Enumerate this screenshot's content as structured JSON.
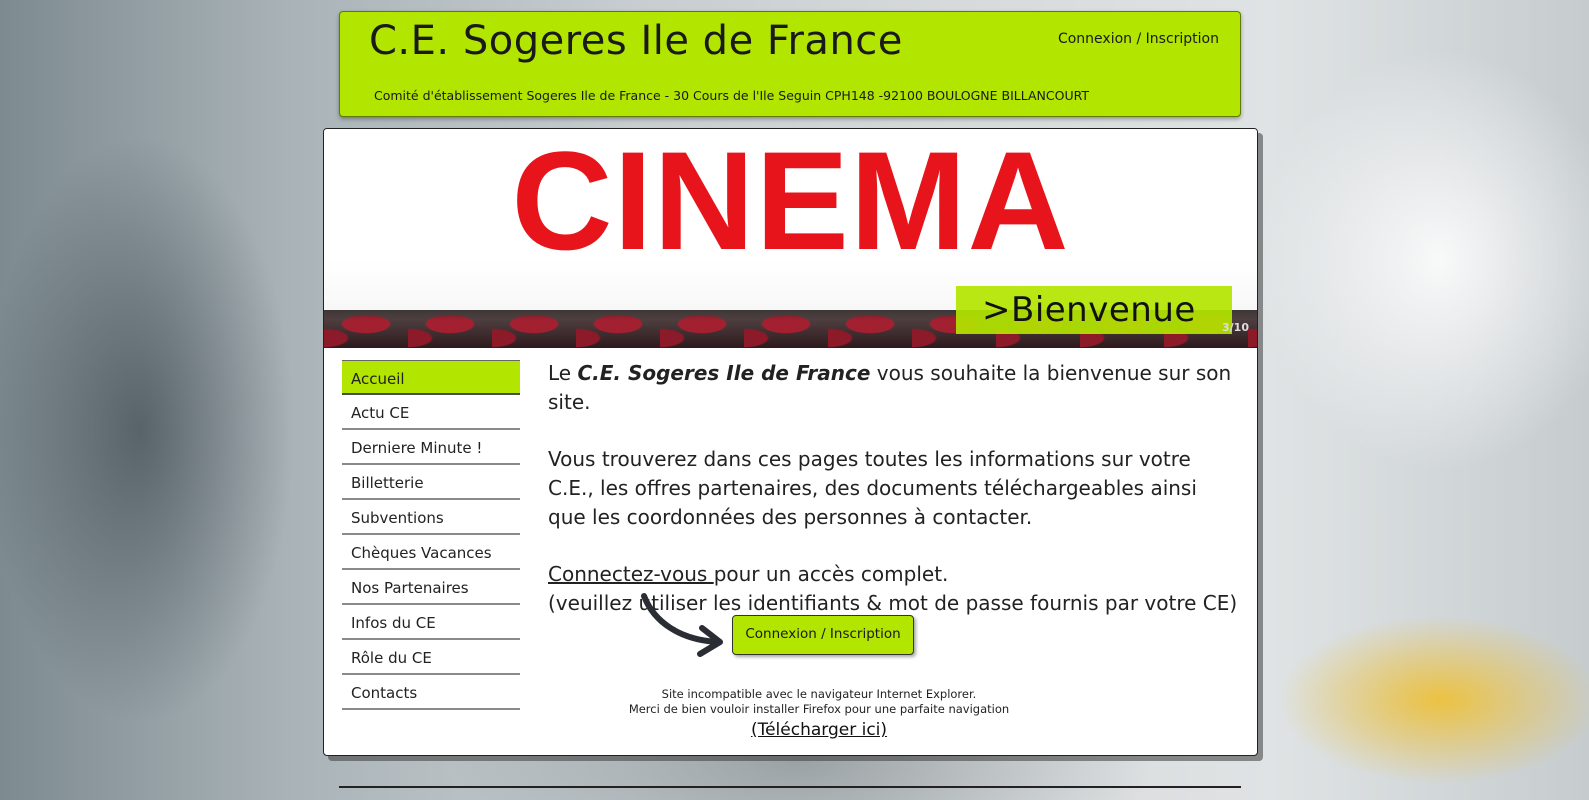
{
  "header": {
    "title": "C.E. Sogeres Ile de France",
    "subtitle": "Comité d'établissement Sogeres Ile de France - 30 Cours de l'Ile Seguin CPH148 -92100 BOULOGNE BILLANCOURT",
    "login_link": "Connexion / Inscription"
  },
  "slideshow": {
    "banner_text": "CINEMA",
    "caption": ">Bienvenue",
    "counter": "3/10"
  },
  "nav": {
    "items": [
      {
        "label": "Accueil",
        "active": true
      },
      {
        "label": "Actu CE"
      },
      {
        "label": "Derniere Minute !"
      },
      {
        "label": "Billetterie"
      },
      {
        "label": "Subventions"
      },
      {
        "label": "Chèques Vacances"
      },
      {
        "label": "Nos Partenaires"
      },
      {
        "label": "Infos du CE"
      },
      {
        "label": "Rôle du CE"
      },
      {
        "label": "Contacts"
      }
    ]
  },
  "content": {
    "welcome_prefix": "Le ",
    "welcome_name": "C.E. Sogeres Ile de France",
    "welcome_suffix": " vous souhaite la bienvenue sur son site.",
    "intro": "Vous trouverez dans ces pages toutes les informations sur votre C.E., les offres partenaires, des documents téléchargeables ainsi que les coordonnées des personnes à contacter.",
    "connect_link": "Connectez-vous ",
    "connect_suffix": "pour un accès complet.",
    "credentials_note": "(veuillez utiliser les identifiants & mot de passe fournis par votre CE)",
    "cta_button": "Connexion / Inscription",
    "ie_notice_line1": "Site incompatible avec le navigateur Internet Explorer.",
    "ie_notice_line2": "Merci de bien vouloir installer Firefox pour une parfaite navigation",
    "download_link": "(Télécharger ici)"
  },
  "colors": {
    "accent": "#b2e500",
    "banner_red": "#e8141c"
  }
}
